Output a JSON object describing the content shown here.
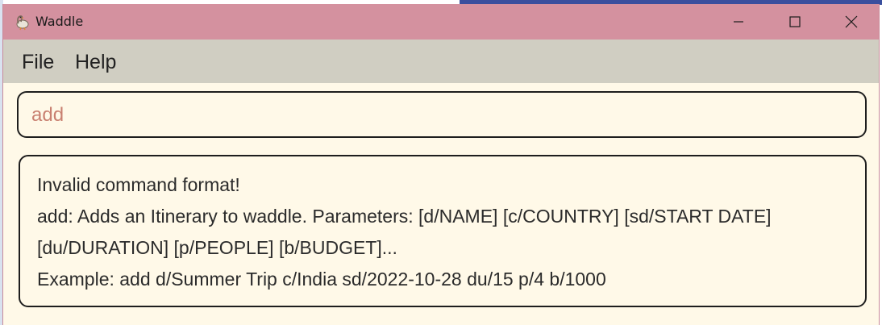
{
  "window": {
    "title": "Waddle",
    "icon": "goose-icon",
    "controls": {
      "minimize_icon": "minimize-icon",
      "maximize_icon": "maximize-icon",
      "close_icon": "close-icon"
    }
  },
  "menubar": {
    "items": [
      {
        "label": "File"
      },
      {
        "label": "Help"
      }
    ]
  },
  "command": {
    "value": "add"
  },
  "result": {
    "lines": [
      "Invalid command format!",
      "add: Adds an Itinerary to waddle. Parameters: [d/NAME] [c/COUNTRY] [sd/START DATE]",
      "[du/DURATION] [p/PEOPLE] [b/BUDGET]...",
      "Example: add d/Summer Trip c/India sd/2022-10-28 du/15 p/4 b/1000"
    ]
  },
  "colors": {
    "titlebar": "#d4919f",
    "menubar": "#d0cec2",
    "background": "#fff9e8",
    "command_text": "#c98070",
    "border": "#1e1e1e"
  }
}
